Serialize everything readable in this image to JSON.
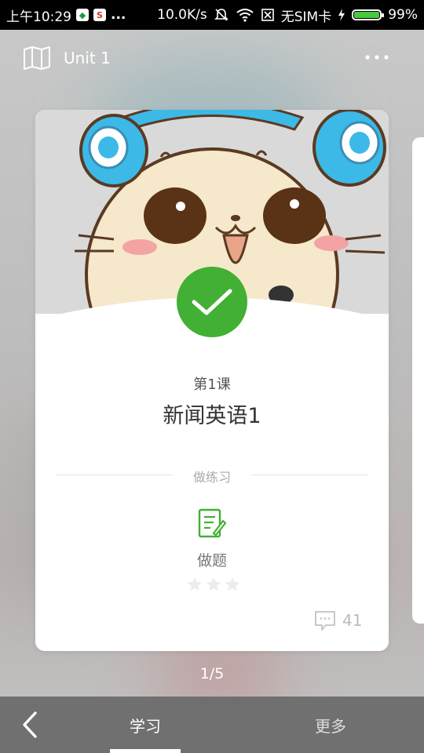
{
  "status_bar": {
    "time": "上午10:29",
    "ellipsis": "...",
    "speed": "10.0K/s",
    "sim": "无SIM卡",
    "battery": "99%",
    "battery_level": 0.99
  },
  "header": {
    "title": "Unit 1",
    "left_icon": "map-icon",
    "right_icon": "more-icon"
  },
  "card": {
    "lesson_number": "第1课",
    "lesson_title": "新闻英语1",
    "section_label": "做练习",
    "exercise_label": "做题",
    "stars_filled": 0,
    "stars_total": 3,
    "comment_count": "41",
    "completed": true
  },
  "pager": {
    "text": "1/5"
  },
  "bottom_nav": {
    "study_label": "学习",
    "more_label": "更多"
  },
  "colors": {
    "accent_green": "#42b034",
    "status_bar_bg": "#000000",
    "bottom_nav_bg": "#696969"
  }
}
